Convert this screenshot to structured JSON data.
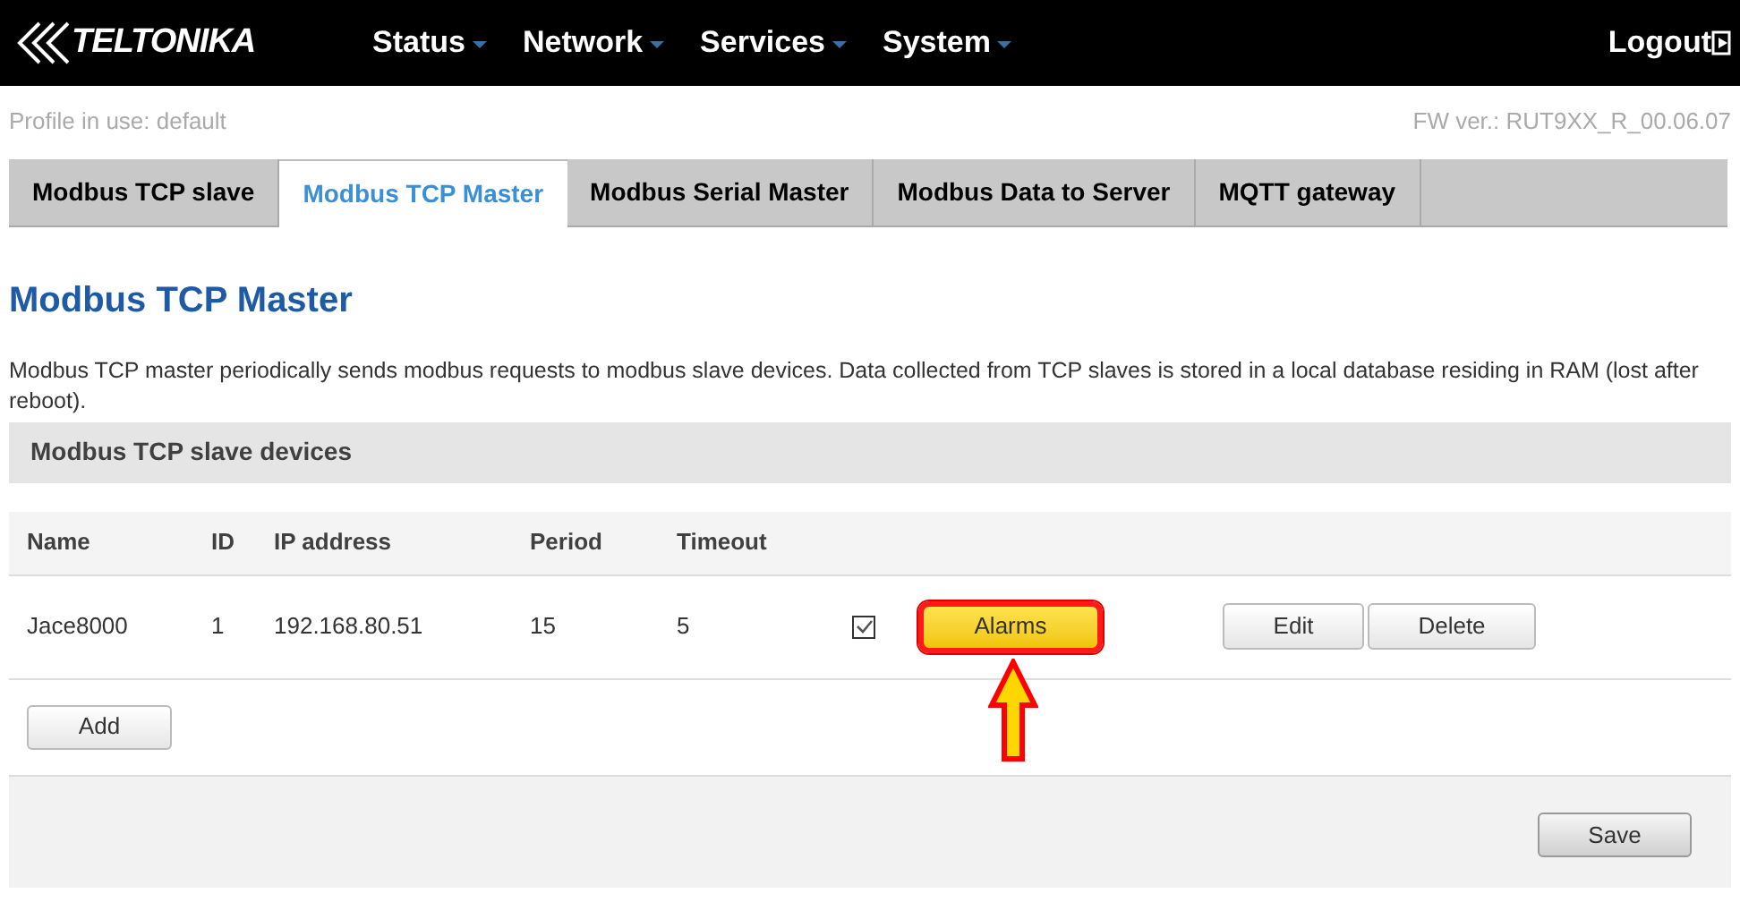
{
  "nav": {
    "logo": "TELTONIKA",
    "menus": [
      "Status",
      "Network",
      "Services",
      "System"
    ],
    "logout": "Logout"
  },
  "profile": "Profile in use: default",
  "firmware": "FW ver.: RUT9XX_R_00.06.07",
  "tabs": [
    {
      "label": "Modbus TCP slave",
      "selected": false
    },
    {
      "label": "Modbus TCP Master",
      "selected": true
    },
    {
      "label": "Modbus Serial Master",
      "selected": false
    },
    {
      "label": "Modbus Data to Server",
      "selected": false
    },
    {
      "label": "MQTT gateway",
      "selected": false
    }
  ],
  "title": "Modbus TCP Master",
  "description": "Modbus TCP master periodically sends modbus requests to modbus slave devices. Data collected from TCP slaves is stored in a local database residing in RAM (lost after reboot).",
  "section": "Modbus TCP slave devices",
  "table": {
    "columns": [
      "Name",
      "ID",
      "IP address",
      "Period",
      "Timeout"
    ],
    "rows": [
      {
        "cells": [
          "Jace8000",
          "1",
          "192.168.80.51",
          "15",
          "5"
        ],
        "checked": true,
        "alarms": "Alarms",
        "alarms_highlighted": true,
        "edit": "Edit",
        "delete": "Delete"
      }
    ]
  },
  "add": "Add",
  "save": "Save"
}
